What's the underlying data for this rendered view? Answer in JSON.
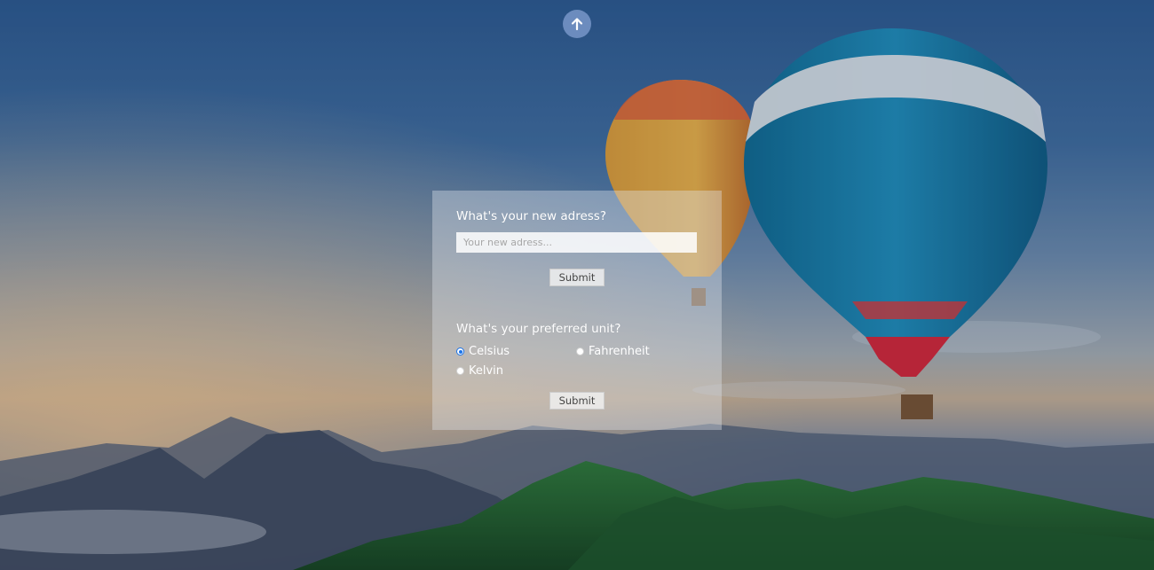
{
  "scroll_top": {
    "icon": "arrow-up-icon"
  },
  "address_form": {
    "question": "What's your new adress?",
    "input_value": "",
    "input_placeholder": "Your new adress...",
    "submit_label": "Submit"
  },
  "unit_form": {
    "question": "What's your preferred unit?",
    "options": [
      {
        "label": "Celsius",
        "checked": true
      },
      {
        "label": "Fahrenheit",
        "checked": false
      },
      {
        "label": "Kelvin",
        "checked": false
      }
    ],
    "submit_label": "Submit"
  },
  "background": {
    "description_icons": [
      "hot-air-balloon-icon",
      "mountains-icon"
    ],
    "accent_color": "#1a73e8"
  }
}
